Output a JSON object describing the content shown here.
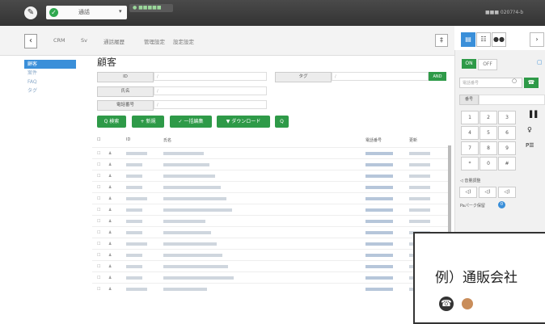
{
  "topbar": {
    "logo": "✎",
    "status_check": "✓",
    "status_text": "通話",
    "dropdown": "▾",
    "badge": "● ■■■■■",
    "right_text": "■■■  0207?4-b"
  },
  "navbar": {
    "back": "‹",
    "tabs": [
      "CRM",
      "Sv",
      "通話履歴",
      "管理設定",
      "設定設定"
    ],
    "pin": "‡"
  },
  "sidebar": {
    "items": [
      "顧客",
      "案件",
      "FAQ",
      "タグ"
    ]
  },
  "page_title": "顧客",
  "form": {
    "fields": [
      {
        "label": "ID",
        "value": "∕"
      },
      {
        "label": "氏名",
        "value": "∕"
      },
      {
        "label": "電話番号",
        "value": "∕"
      }
    ],
    "tag_label": "タグ",
    "tag_value": "∕",
    "tag_button": "AND"
  },
  "actions": {
    "search": "Q 検索",
    "add": "+ 新規",
    "bulk_edit": "✓ 一括編集",
    "download": "▼ ダウンロード",
    "search_icon": "Q"
  },
  "table": {
    "headers": [
      "☐",
      "ID",
      "氏名",
      "電話番号",
      "更新"
    ],
    "row_count": 13
  },
  "right_panel": {
    "icons": [
      "▤",
      "☷",
      "●●",
      "›"
    ],
    "on": "ON",
    "off": "OFF",
    "lock": "▢",
    "phone_placeholder": "電話番号",
    "call_icon": "☎",
    "number_label": "番号",
    "keys": [
      "1",
      "2",
      "3",
      "4",
      "5",
      "6",
      "7",
      "8",
      "9",
      "*",
      "0",
      "#"
    ],
    "side_keys": [
      "▐▐",
      "♀",
      "P☰"
    ],
    "volume_label": "◁ 音量調整",
    "volume_keys": [
      "◁)",
      "◁)",
      "◁)"
    ],
    "park_label": "Paパーク保留",
    "park_count": "0"
  },
  "callout": {
    "text": "例）通販会社",
    "phone_icon": "☎"
  }
}
